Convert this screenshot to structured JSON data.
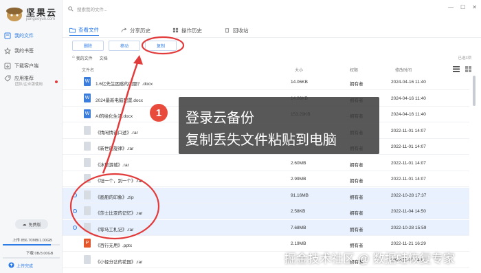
{
  "app": {
    "brand_name": "坚果云",
    "brand_url": "jianguoyun.com"
  },
  "sidebar": {
    "items": [
      {
        "label": "我的文件",
        "icon": "file-icon",
        "active": true
      },
      {
        "label": "我的书签",
        "icon": "star-icon",
        "active": false
      },
      {
        "label": "下载客户端",
        "icon": "download-icon",
        "active": false
      },
      {
        "label": "应用推荐",
        "icon": "tag-icon",
        "active": false
      }
    ],
    "app_sub": "团队/企业版使用",
    "free_label": "免费版",
    "upload_quota": "上传 856.70MB/1.00GB",
    "upload_ratio": 0.84,
    "download_quota": "下载 0B/3.00GB",
    "download_ratio": 0.0,
    "upload_done": "上传完成"
  },
  "search": {
    "placeholder": "搜索我的文件..."
  },
  "tabs": [
    {
      "label": "查看文件",
      "active": true
    },
    {
      "label": "分享历史",
      "active": false
    },
    {
      "label": "操作历史",
      "active": false
    },
    {
      "label": "回收站",
      "active": false
    }
  ],
  "toolbar": {
    "delete": "删除",
    "move": "移动",
    "copy": "复制"
  },
  "breadcrumb": {
    "root": "我的文件",
    "current": "文档"
  },
  "selected_count": "已选3项",
  "columns": {
    "name": "文件名",
    "size": "大小",
    "perm": "权限",
    "modified": "修改时间"
  },
  "files": [
    {
      "name": "1.6亿先生困惑的问题？.docx",
      "size": "14.06KB",
      "perm": "拥有者",
      "date": "2024-04-16 11:40",
      "type": "docx",
      "selected": false
    },
    {
      "name": "2024最新电脑配置.docx",
      "size": "14.06KB",
      "perm": "拥有者",
      "date": "2024-04-16 11:40",
      "type": "docx",
      "selected": false
    },
    {
      "name": "AI的绘化生活.docx",
      "size": "153.29KB",
      "perm": "拥有者",
      "date": "2024-04-16 11:40",
      "type": "docx",
      "selected": false
    },
    {
      "name": "《情闲情调口述》.rar",
      "size": "",
      "perm": "拥有者",
      "date": "2022-11-01 14:07",
      "type": "rar",
      "selected": false
    },
    {
      "name": "《新世的旋律》.rar",
      "size": "",
      "perm": "拥有者",
      "date": "2022-11-01 14:07",
      "type": "rar",
      "selected": false
    },
    {
      "name": "《沐旅游城》.rar",
      "size": "2.60MB",
      "perm": "拥有者",
      "date": "2022-11-01 14:07",
      "type": "rar",
      "selected": false
    },
    {
      "name": "《坦一个，到一个》.rar",
      "size": "2.99MB",
      "perm": "拥有者",
      "date": "2022-11-01 14:07",
      "type": "rar",
      "selected": false
    },
    {
      "name": "《画册的印象》.zip",
      "size": "91.16MB",
      "perm": "拥有者",
      "date": "2022-10-28 17:37",
      "type": "zip",
      "selected": true
    },
    {
      "name": "《莎士比亚的记忆》.rar",
      "size": "2.58KB",
      "perm": "拥有者",
      "date": "2022-11-04 14:50",
      "type": "rar",
      "selected": true
    },
    {
      "name": "《零马工札记》.rar",
      "size": "7.68MB",
      "perm": "拥有者",
      "date": "2022-10-28 15:59",
      "type": "rar",
      "selected": true
    },
    {
      "name": "《百行无用》.pptx",
      "size": "2.19MB",
      "perm": "拥有者",
      "date": "2022-11-21 16:29",
      "type": "pptx",
      "selected": false
    },
    {
      "name": "《小径分岔的花园》.rar",
      "size": "",
      "perm": "拥有者",
      "date": "2022-11-01 14:07",
      "type": "rar",
      "selected": false
    }
  ],
  "callout": {
    "step": "1",
    "line1": "登录云备份",
    "line2": "复制丢失文件粘贴到电脑"
  },
  "watermark": "掘金技术社区 @ 数据蛙恢复专家",
  "colors": {
    "accent": "#2d7be5",
    "annotation": "#e23b3b",
    "selected_row": "#e8f1fd"
  }
}
